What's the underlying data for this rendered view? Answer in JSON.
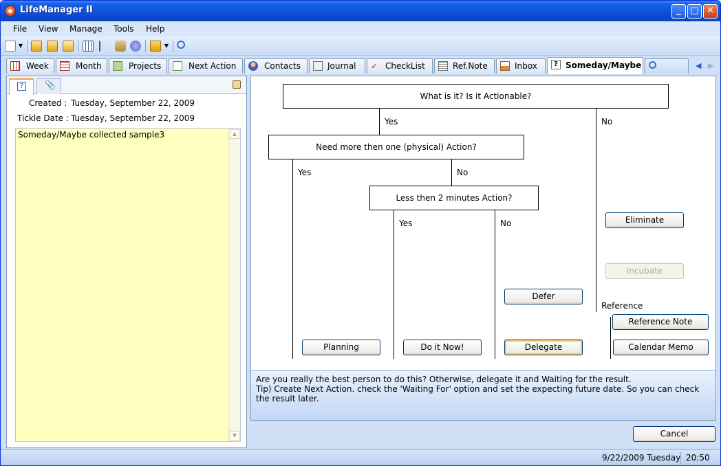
{
  "window": {
    "title": "LifeManager II",
    "minimize": "_",
    "maximize": "□",
    "close": "✕"
  },
  "menu": {
    "file": "File",
    "view": "View",
    "manage": "Manage",
    "tools": "Tools",
    "help": "Help"
  },
  "tabs": {
    "week": "Week",
    "month": "Month",
    "projects": "Projects",
    "next_action": "Next Action",
    "contacts": "Contacts",
    "journal": "Journal",
    "checklist": "CheckList",
    "ref_note": "Ref.Note",
    "inbox": "Inbox",
    "someday": "Someday/Maybe"
  },
  "left": {
    "created_label": "Created :",
    "created_value": "Tuesday, September 22, 2009",
    "tickle_label": "Tickle Date :",
    "tickle_value": "Tuesday, September 22, 2009",
    "memo_text": "Someday/Maybe collected sample3"
  },
  "flow": {
    "q1": "What is it? Is it Actionable?",
    "q2": "Need more then one (physical) Action?",
    "q3": "Less then 2 minutes Action?",
    "yes": "Yes",
    "no": "No",
    "reference": "Reference",
    "buttons": {
      "eliminate": "Eliminate",
      "incubate": "Incubate",
      "defer": "Defer",
      "reference_note": "Reference Note",
      "planning": "Planning",
      "do_it_now": "Do it Now!",
      "delegate": "Delegate",
      "calendar_memo": "Calendar Memo"
    }
  },
  "tip": {
    "line1": "Are you really the best person to do this? Otherwise, delegate it and Waiting for the result.",
    "line2": "Tip) Create Next Action. check the 'Waiting For' option and set the expecting future date. So you can check the result later."
  },
  "cancel_label": "Cancel",
  "status": {
    "date": "9/22/2009 Tuesday",
    "time": "20:50"
  }
}
